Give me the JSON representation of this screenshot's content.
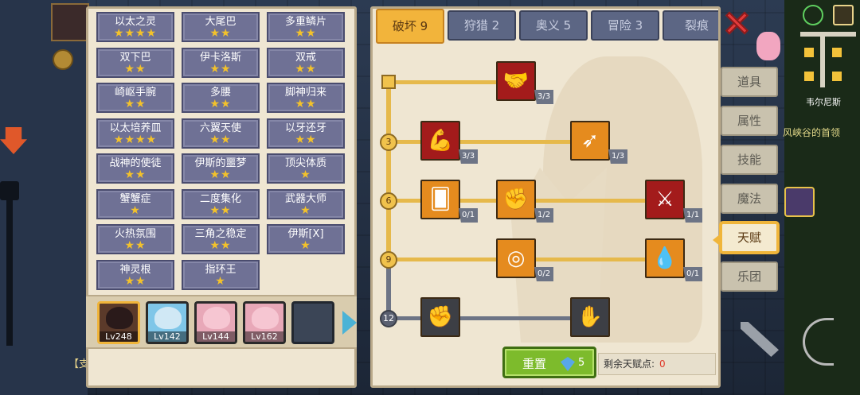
{
  "bottom_left_text": "【支",
  "skill_cards": [
    {
      "name": "以太之灵",
      "stars": "★★★★"
    },
    {
      "name": "大尾巴",
      "stars": "★★"
    },
    {
      "name": "多重鳞片",
      "stars": "★★"
    },
    {
      "name": "双下巴",
      "stars": "★★"
    },
    {
      "name": "伊卡洛斯",
      "stars": "★★"
    },
    {
      "name": "双戒",
      "stars": "★★"
    },
    {
      "name": "崎岖手腕",
      "stars": "★★"
    },
    {
      "name": "多腰",
      "stars": "★★"
    },
    {
      "name": "脚神归来",
      "stars": "★★"
    },
    {
      "name": "以太培养皿",
      "stars": "★★★★"
    },
    {
      "name": "六翼天使",
      "stars": "★★"
    },
    {
      "name": "以牙还牙",
      "stars": "★★"
    },
    {
      "name": "战神的使徒",
      "stars": "★★"
    },
    {
      "name": "伊斯的噩梦",
      "stars": "★★"
    },
    {
      "name": "顶尖体质",
      "stars": "★"
    },
    {
      "name": "蟹蟹症",
      "stars": "★"
    },
    {
      "name": "二度集化",
      "stars": "★★"
    },
    {
      "name": "武器大师",
      "stars": "★"
    },
    {
      "name": "火热氛围",
      "stars": "★★"
    },
    {
      "name": "三角之稳定",
      "stars": "★★"
    },
    {
      "name": "伊斯[X]",
      "stars": "★"
    },
    {
      "name": "神灵根",
      "stars": "★★"
    },
    {
      "name": "指环王",
      "stars": "★"
    }
  ],
  "characters": [
    {
      "level": "Lv248",
      "selected": true
    },
    {
      "level": "Lv142",
      "selected": false
    },
    {
      "level": "Lv144",
      "selected": false
    },
    {
      "level": "Lv162",
      "selected": false
    }
  ],
  "tabs": [
    {
      "label": "破坏 9",
      "active": true
    },
    {
      "label": "狩猎 2",
      "active": false
    },
    {
      "label": "奥义 5",
      "active": false
    },
    {
      "label": "冒险 3",
      "active": false
    },
    {
      "label": "裂痕",
      "active": false
    }
  ],
  "levels": {
    "l3": "3",
    "l6": "6",
    "l9": "9",
    "l12": "12"
  },
  "talent_nodes": [
    {
      "name": "arm-wrestle-talent",
      "count": "3/3",
      "color": "red",
      "icon": "handshake-icon",
      "glyph": "🤝"
    },
    {
      "name": "muscle-body-talent",
      "count": "3/3",
      "color": "red",
      "icon": "body-icon",
      "glyph": "💪"
    },
    {
      "name": "flaming-arrow-talent",
      "count": "1/3",
      "color": "orange",
      "icon": "arrow-icon",
      "glyph": "➶"
    },
    {
      "name": "card-talent",
      "count": "0/1",
      "color": "orange",
      "icon": "cards-icon",
      "glyph": "🂠"
    },
    {
      "name": "fist-punch-talent",
      "count": "1/2",
      "color": "orange",
      "icon": "punch-icon",
      "glyph": "✊"
    },
    {
      "name": "blade-strike-talent",
      "count": "1/1",
      "color": "red",
      "icon": "blade-icon",
      "glyph": "⚔"
    },
    {
      "name": "ripple-talent",
      "count": "0/2",
      "color": "orange",
      "icon": "ripple-icon",
      "glyph": "◎"
    },
    {
      "name": "drops-talent",
      "count": "0/1",
      "color": "orange",
      "icon": "drops-icon",
      "glyph": "💧"
    },
    {
      "name": "fist-locked-talent",
      "count": "",
      "color": "gray",
      "icon": "fist-icon",
      "glyph": "✊"
    },
    {
      "name": "grip-locked-talent",
      "count": "",
      "color": "gray",
      "icon": "grip-icon",
      "glyph": "✋"
    }
  ],
  "reset": {
    "label": "重置",
    "gem_count": "5"
  },
  "remaining": {
    "label": "剩余天赋点:",
    "value": "0"
  },
  "side_menu": [
    {
      "label": "道具",
      "active": false
    },
    {
      "label": "属性",
      "active": false
    },
    {
      "label": "技能",
      "active": false
    },
    {
      "label": "魔法",
      "active": false
    },
    {
      "label": "天赋",
      "active": true
    },
    {
      "label": "乐团",
      "active": false
    }
  ],
  "map": {
    "label": "韦尔尼斯",
    "label2": "风峡谷的首领"
  },
  "colors": {
    "accent": "#f2b43b",
    "card": "#6f7195",
    "reset_green": "#7dbb2c",
    "close_red": "#e23b3b"
  }
}
